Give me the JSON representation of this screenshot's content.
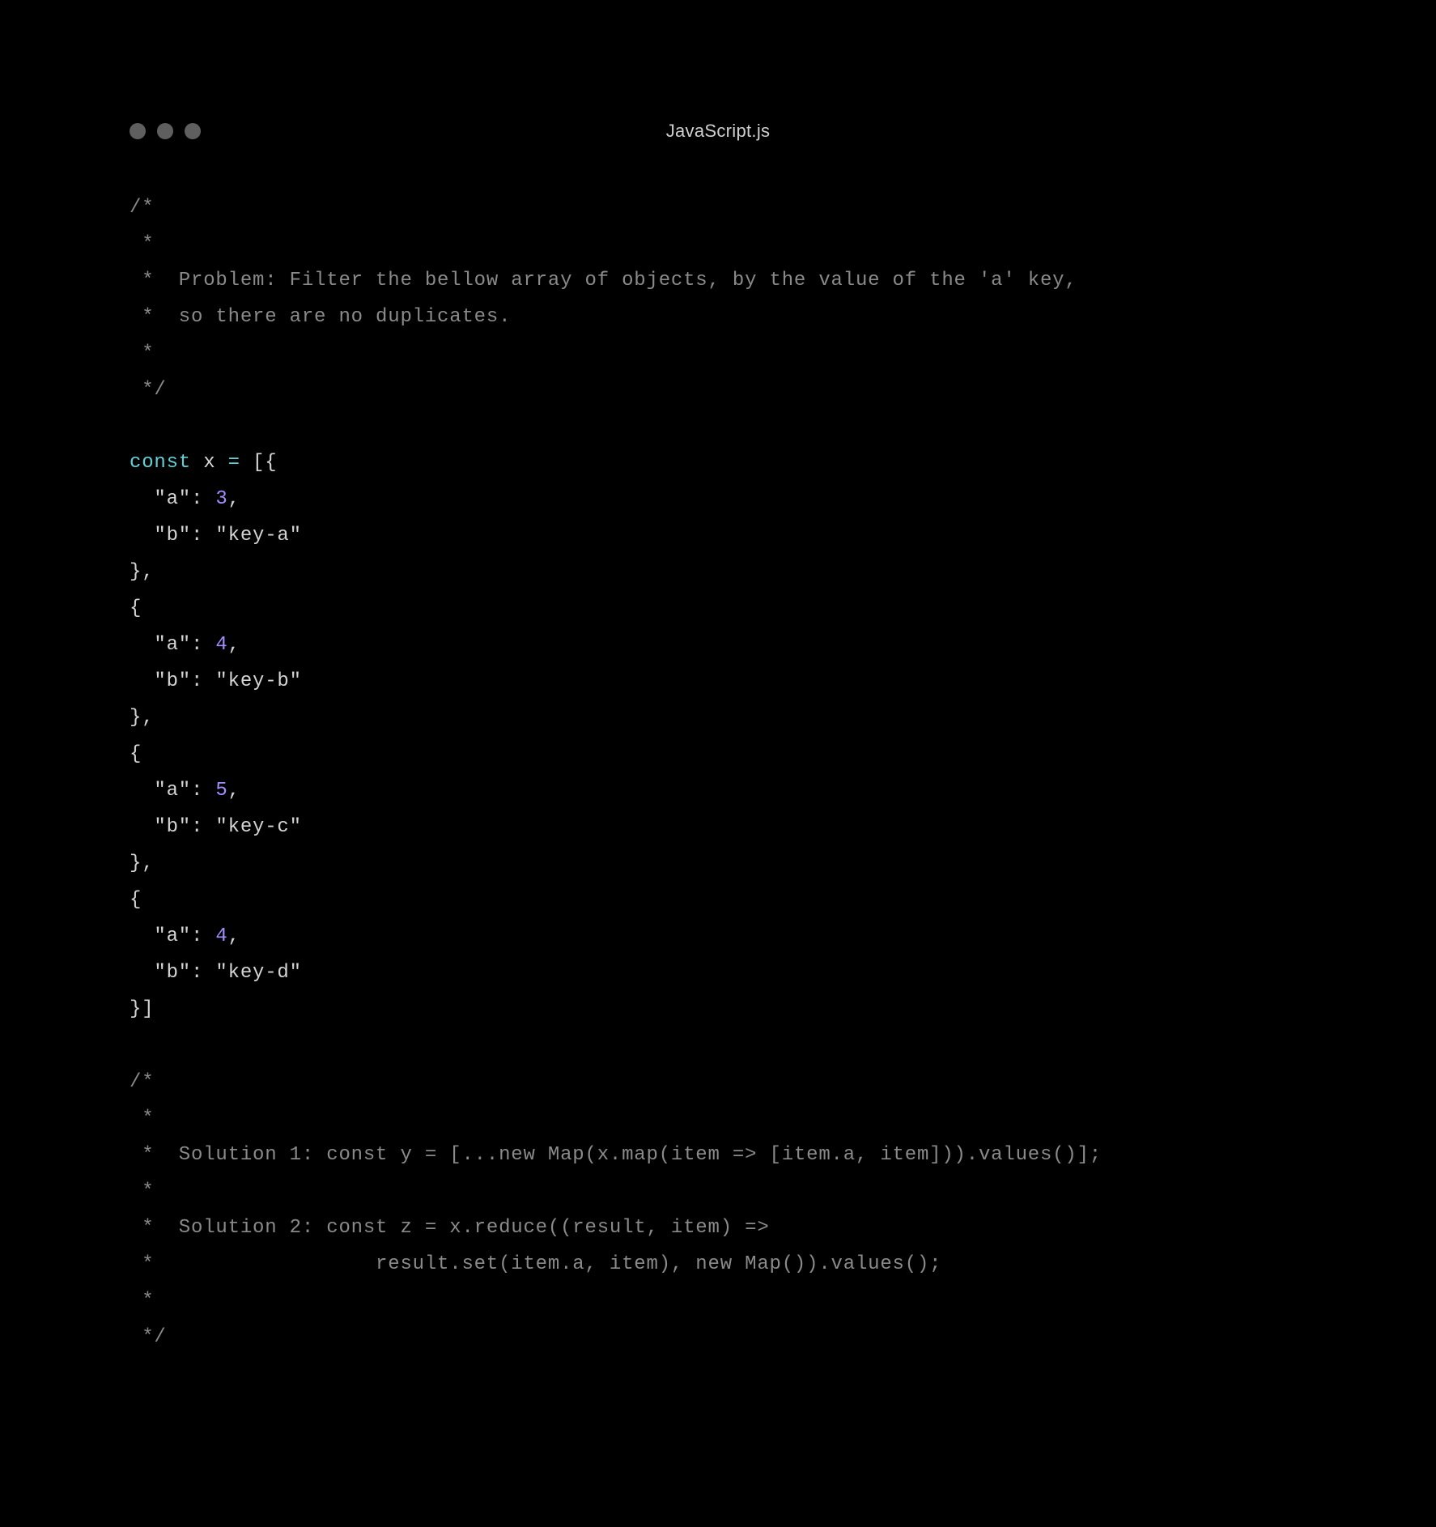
{
  "title": "JavaScript.js",
  "comment1": {
    "l1": "/*",
    "l2": " *",
    "l3": " *  Problem: Filter the bellow array of objects, by the value of the 'a' key,",
    "l4": " *  so there are no duplicates.",
    "l5": " *",
    "l6": " */"
  },
  "decl": {
    "kw": "const",
    "id": "x",
    "eq": "=",
    "open": "[{"
  },
  "obj1": {
    "a_key": "\"a\"",
    "a_val": "3",
    "b_key": "\"b\"",
    "b_val": "\"key-a\""
  },
  "obj2": {
    "a_key": "\"a\"",
    "a_val": "4",
    "b_key": "\"b\"",
    "b_val": "\"key-b\""
  },
  "obj3": {
    "a_key": "\"a\"",
    "a_val": "5",
    "b_key": "\"b\"",
    "b_val": "\"key-c\""
  },
  "obj4": {
    "a_key": "\"a\"",
    "a_val": "4",
    "b_key": "\"b\"",
    "b_val": "\"key-d\""
  },
  "close": "}]",
  "comment2": {
    "l1": "/*",
    "l2": " *",
    "l3": " *  Solution 1: const y = [...new Map(x.map(item => [item.a, item])).values()];",
    "l4": " *",
    "l5": " *  Solution 2: const z = x.reduce((result, item) =>",
    "l6": " *                  result.set(item.a, item), new Map()).values();",
    "l7": " *",
    "l8": " */"
  },
  "sep": {
    "colon": ":",
    "comma": ",",
    "brace_c_comma": "},",
    "brace_o": "{"
  }
}
